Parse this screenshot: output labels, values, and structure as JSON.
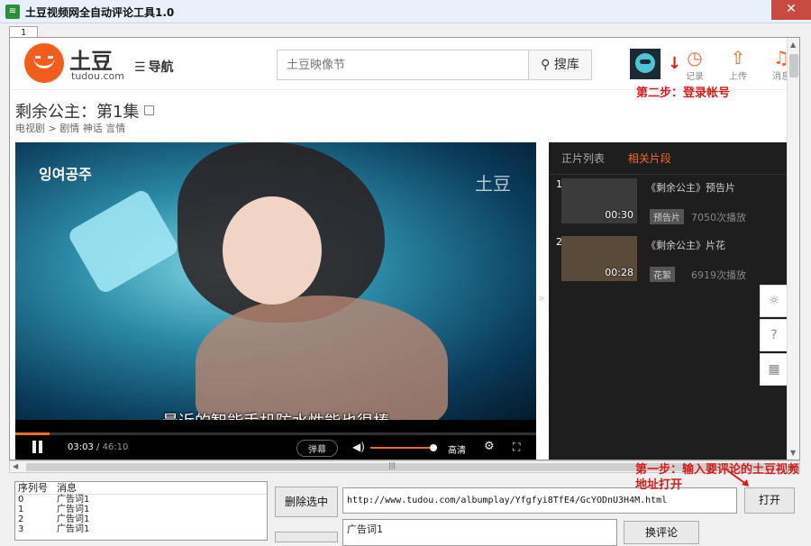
{
  "window": {
    "title": "土豆视频网全自动评论工具1.0",
    "tab_label": "1"
  },
  "site": {
    "logo_text": "土豆",
    "logo_sub": "tudou.com",
    "nav_label": "导航",
    "search_placeholder": "土豆映像节",
    "search_button": "搜库",
    "header_icons": [
      {
        "icon": "clock-icon",
        "label": "记录"
      },
      {
        "icon": "upload-icon",
        "label": "上传"
      },
      {
        "icon": "bell-icon",
        "label": "消息"
      }
    ]
  },
  "video": {
    "title": "剩余公主：第1集",
    "breadcrumb": "电视剧 > 剧情 神话 言情",
    "overlay_logo": "잉여공주",
    "watermark": "土豆",
    "subtitle": "最近的智能手机防水性能也很棒",
    "current_time": "03:03",
    "total_time": "46:10",
    "progress_fraction": 0.066,
    "danmu_label": "弹幕",
    "volume_fraction": 0.95,
    "quality": "高清"
  },
  "side": {
    "tabs": [
      "正片列表",
      "相关片段"
    ],
    "active_tab": 1,
    "clips": [
      {
        "num": "1",
        "duration": "00:30",
        "title": "《剩余公主》预告片",
        "tag": "预告片",
        "plays": "7050次播放"
      },
      {
        "num": "2",
        "duration": "00:28",
        "title": "《剩余公主》片花",
        "tag": "花絮",
        "plays": "6919次播放"
      }
    ]
  },
  "annotations": {
    "step2": "第二步：登录帐号",
    "step1_line1": "第一步：输入要评论的土豆视频",
    "step1_line2": "地址打开"
  },
  "app": {
    "table_headers": [
      "序列号",
      "消息"
    ],
    "table_rows": [
      {
        "seq": "0",
        "msg": "广告词1"
      },
      {
        "seq": "1",
        "msg": "广告词1"
      },
      {
        "seq": "2",
        "msg": "广告词1"
      },
      {
        "seq": "3",
        "msg": "广告词1"
      }
    ],
    "delete_button": "删除选中",
    "url_value": "http://www.tudou.com/albumplay/Yfgfyi8TfE4/GcYODnU3H4M.html",
    "open_button": "打开",
    "comment_text": "广告词1",
    "change_comment_button": "换评论"
  }
}
